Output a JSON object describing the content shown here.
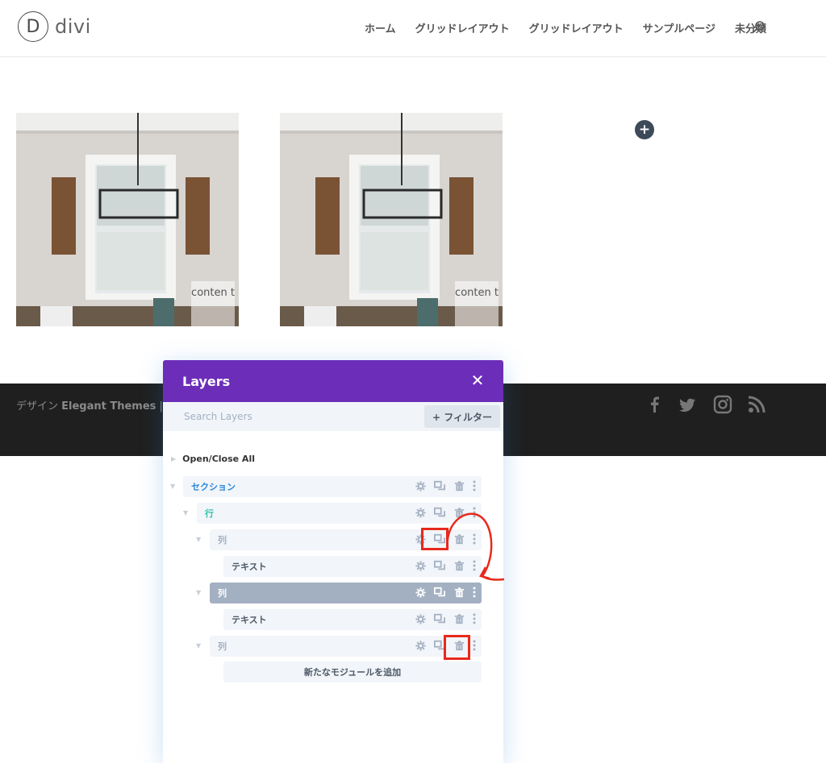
{
  "site": {
    "logo_letter": "D",
    "logo_text": "divi"
  },
  "nav": {
    "items": [
      "ホーム",
      "グリッドレイアウト",
      "グリッドレイアウト",
      "サンプルページ",
      "未分類"
    ]
  },
  "cards": [
    {
      "label": "conten t"
    },
    {
      "label": "conten t"
    }
  ],
  "add_column_button": "+",
  "footer": {
    "credit_prefix": "デザイン ",
    "credit_brand": "Elegant Themes",
    "credit_suffix": " | 提供"
  },
  "layers": {
    "title": "Layers",
    "close_glyph": "✕",
    "search_placeholder": "Search Layers",
    "filter_label": "+ フィルター",
    "open_close_all": "Open/Close All",
    "tree": {
      "section": "セクション",
      "row": "行",
      "column_1": "列",
      "text_1": "テキスト",
      "column_2": "列",
      "text_2": "テキスト",
      "column_3": "列"
    },
    "add_module": "新たなモジュールを追加"
  },
  "colors": {
    "panel_header": "#6c2eb9",
    "section_label": "#2b87da",
    "row_label": "#29c4a9",
    "column_label": "#a3b0c2",
    "selected_row": "#a3b0c2",
    "footer_bg": "#1f1f1f",
    "highlight": "#e8291c"
  }
}
